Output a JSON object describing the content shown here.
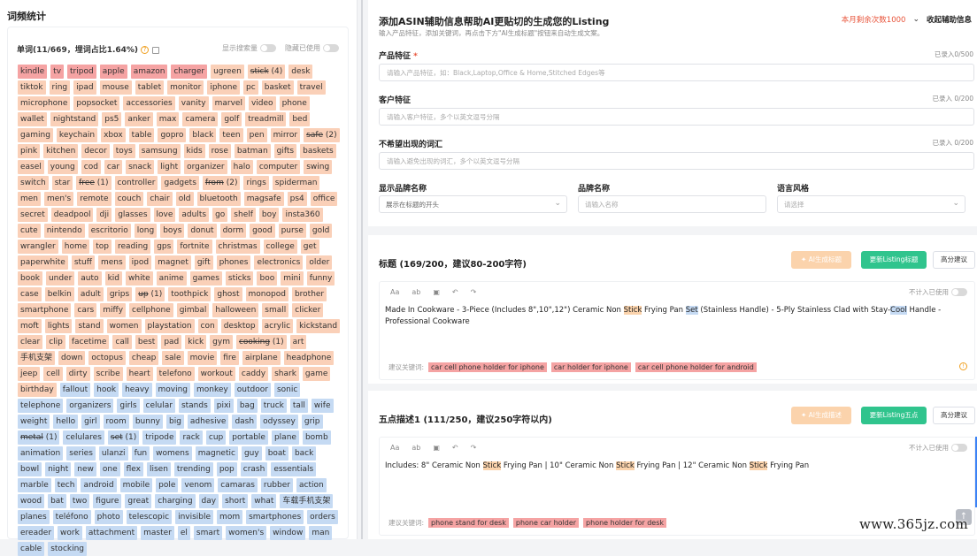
{
  "left": {
    "title": "词频统计",
    "stat": "单词(11/669，埋词占比1.64%)",
    "toggle_show_search": "显示搜索量",
    "toggle_hide_used": "隐藏已使用"
  },
  "tags": [
    {
      "t": "kindle",
      "c": "red"
    },
    {
      "t": "tv",
      "c": "red"
    },
    {
      "t": "tripod",
      "c": "red"
    },
    {
      "t": "apple",
      "c": "red"
    },
    {
      "t": "amazon",
      "c": "red"
    },
    {
      "t": "charger",
      "c": "red"
    },
    {
      "t": "ugreen",
      "c": "peach"
    },
    {
      "t": "stick",
      "c": "peach",
      "s": true,
      "n": "(4)"
    },
    {
      "t": "desk",
      "c": "peach"
    },
    {
      "t": "tiktok",
      "c": "peach"
    },
    {
      "t": "ring",
      "c": "peach"
    },
    {
      "t": "ipad",
      "c": "peach"
    },
    {
      "t": "mouse",
      "c": "peach"
    },
    {
      "t": "tablet",
      "c": "peach"
    },
    {
      "t": "monitor",
      "c": "peach"
    },
    {
      "t": "iphone",
      "c": "peach"
    },
    {
      "t": "pc",
      "c": "peach"
    },
    {
      "t": "basket",
      "c": "peach"
    },
    {
      "t": "travel",
      "c": "peach"
    },
    {
      "t": "microphone",
      "c": "peach"
    },
    {
      "t": "popsocket",
      "c": "peach"
    },
    {
      "t": "accessories",
      "c": "peach"
    },
    {
      "t": "vanity",
      "c": "peach"
    },
    {
      "t": "marvel",
      "c": "peach"
    },
    {
      "t": "video",
      "c": "peach"
    },
    {
      "t": "phone",
      "c": "peach"
    },
    {
      "t": "wallet",
      "c": "peach"
    },
    {
      "t": "nightstand",
      "c": "peach"
    },
    {
      "t": "ps5",
      "c": "peach"
    },
    {
      "t": "anker",
      "c": "peach"
    },
    {
      "t": "max",
      "c": "peach"
    },
    {
      "t": "camera",
      "c": "peach"
    },
    {
      "t": "golf",
      "c": "peach"
    },
    {
      "t": "treadmill",
      "c": "peach"
    },
    {
      "t": "bed",
      "c": "peach"
    },
    {
      "t": "gaming",
      "c": "peach"
    },
    {
      "t": "keychain",
      "c": "peach"
    },
    {
      "t": "xbox",
      "c": "peach"
    },
    {
      "t": "table",
      "c": "peach"
    },
    {
      "t": "gopro",
      "c": "peach"
    },
    {
      "t": "black",
      "c": "peach"
    },
    {
      "t": "teen",
      "c": "peach"
    },
    {
      "t": "pen",
      "c": "peach"
    },
    {
      "t": "mirror",
      "c": "peach"
    },
    {
      "t": "safe",
      "c": "peach",
      "s": true,
      "n": "(2)"
    },
    {
      "t": "pink",
      "c": "peach"
    },
    {
      "t": "kitchen",
      "c": "peach"
    },
    {
      "t": "decor",
      "c": "peach"
    },
    {
      "t": "toys",
      "c": "peach"
    },
    {
      "t": "samsung",
      "c": "peach"
    },
    {
      "t": "kids",
      "c": "peach"
    },
    {
      "t": "rose",
      "c": "peach"
    },
    {
      "t": "batman",
      "c": "peach"
    },
    {
      "t": "gifts",
      "c": "peach"
    },
    {
      "t": "baskets",
      "c": "peach"
    },
    {
      "t": "easel",
      "c": "peach"
    },
    {
      "t": "young",
      "c": "peach"
    },
    {
      "t": "cod",
      "c": "peach"
    },
    {
      "t": "car",
      "c": "peach"
    },
    {
      "t": "snack",
      "c": "peach"
    },
    {
      "t": "light",
      "c": "peach"
    },
    {
      "t": "organizer",
      "c": "peach"
    },
    {
      "t": "halo",
      "c": "peach"
    },
    {
      "t": "computer",
      "c": "peach"
    },
    {
      "t": "swing",
      "c": "peach"
    },
    {
      "t": "switch",
      "c": "peach"
    },
    {
      "t": "star",
      "c": "peach"
    },
    {
      "t": "free",
      "c": "peach",
      "s": true,
      "n": "(1)"
    },
    {
      "t": "controller",
      "c": "peach"
    },
    {
      "t": "gadgets",
      "c": "peach"
    },
    {
      "t": "from",
      "c": "peach",
      "s": true,
      "n": "(2)"
    },
    {
      "t": "rings",
      "c": "peach"
    },
    {
      "t": "spiderman",
      "c": "peach"
    },
    {
      "t": "men",
      "c": "peach"
    },
    {
      "t": "men's",
      "c": "peach"
    },
    {
      "t": "remote",
      "c": "peach"
    },
    {
      "t": "couch",
      "c": "peach"
    },
    {
      "t": "chair",
      "c": "peach"
    },
    {
      "t": "old",
      "c": "peach"
    },
    {
      "t": "bluetooth",
      "c": "peach"
    },
    {
      "t": "magsafe",
      "c": "peach"
    },
    {
      "t": "ps4",
      "c": "peach"
    },
    {
      "t": "office",
      "c": "peach"
    },
    {
      "t": "secret",
      "c": "peach"
    },
    {
      "t": "deadpool",
      "c": "peach"
    },
    {
      "t": "dji",
      "c": "peach"
    },
    {
      "t": "glasses",
      "c": "peach"
    },
    {
      "t": "love",
      "c": "peach"
    },
    {
      "t": "adults",
      "c": "peach"
    },
    {
      "t": "go",
      "c": "peach"
    },
    {
      "t": "shelf",
      "c": "peach"
    },
    {
      "t": "boy",
      "c": "peach"
    },
    {
      "t": "insta360",
      "c": "peach"
    },
    {
      "t": "cute",
      "c": "peach"
    },
    {
      "t": "nintendo",
      "c": "peach"
    },
    {
      "t": "escritorio",
      "c": "peach"
    },
    {
      "t": "long",
      "c": "peach"
    },
    {
      "t": "boys",
      "c": "peach"
    },
    {
      "t": "donut",
      "c": "peach"
    },
    {
      "t": "dorm",
      "c": "peach"
    },
    {
      "t": "good",
      "c": "peach"
    },
    {
      "t": "purse",
      "c": "peach"
    },
    {
      "t": "gold",
      "c": "peach"
    },
    {
      "t": "wrangler",
      "c": "peach"
    },
    {
      "t": "home",
      "c": "peach"
    },
    {
      "t": "top",
      "c": "peach"
    },
    {
      "t": "reading",
      "c": "peach"
    },
    {
      "t": "gps",
      "c": "peach"
    },
    {
      "t": "fortnite",
      "c": "peach"
    },
    {
      "t": "christmas",
      "c": "peach"
    },
    {
      "t": "college",
      "c": "peach"
    },
    {
      "t": "get",
      "c": "peach"
    },
    {
      "t": "paperwhite",
      "c": "peach"
    },
    {
      "t": "stuff",
      "c": "peach"
    },
    {
      "t": "mens",
      "c": "peach"
    },
    {
      "t": "ipod",
      "c": "peach"
    },
    {
      "t": "magnet",
      "c": "peach"
    },
    {
      "t": "gift",
      "c": "peach"
    },
    {
      "t": "phones",
      "c": "peach"
    },
    {
      "t": "electronics",
      "c": "peach"
    },
    {
      "t": "older",
      "c": "peach"
    },
    {
      "t": "book",
      "c": "peach"
    },
    {
      "t": "under",
      "c": "peach"
    },
    {
      "t": "auto",
      "c": "peach"
    },
    {
      "t": "kid",
      "c": "peach"
    },
    {
      "t": "white",
      "c": "peach"
    },
    {
      "t": "anime",
      "c": "peach"
    },
    {
      "t": "games",
      "c": "peach"
    },
    {
      "t": "sticks",
      "c": "peach"
    },
    {
      "t": "boo",
      "c": "peach"
    },
    {
      "t": "mini",
      "c": "peach"
    },
    {
      "t": "funny",
      "c": "peach"
    },
    {
      "t": "case",
      "c": "peach"
    },
    {
      "t": "belkin",
      "c": "peach"
    },
    {
      "t": "adult",
      "c": "peach"
    },
    {
      "t": "grips",
      "c": "peach"
    },
    {
      "t": "up",
      "c": "peach",
      "s": true,
      "n": "(1)"
    },
    {
      "t": "toothpick",
      "c": "peach"
    },
    {
      "t": "ghost",
      "c": "peach"
    },
    {
      "t": "monopod",
      "c": "peach"
    },
    {
      "t": "brother",
      "c": "peach"
    },
    {
      "t": "smartphone",
      "c": "peach"
    },
    {
      "t": "cars",
      "c": "peach"
    },
    {
      "t": "miffy",
      "c": "peach"
    },
    {
      "t": "cellphone",
      "c": "peach"
    },
    {
      "t": "gimbal",
      "c": "peach"
    },
    {
      "t": "halloween",
      "c": "peach"
    },
    {
      "t": "small",
      "c": "peach"
    },
    {
      "t": "clicker",
      "c": "peach"
    },
    {
      "t": "moft",
      "c": "peach"
    },
    {
      "t": "lights",
      "c": "peach"
    },
    {
      "t": "stand",
      "c": "peach"
    },
    {
      "t": "women",
      "c": "peach"
    },
    {
      "t": "playstation",
      "c": "peach"
    },
    {
      "t": "con",
      "c": "peach"
    },
    {
      "t": "desktop",
      "c": "peach"
    },
    {
      "t": "acrylic",
      "c": "peach"
    },
    {
      "t": "kickstand",
      "c": "peach"
    },
    {
      "t": "clear",
      "c": "peach"
    },
    {
      "t": "clip",
      "c": "peach"
    },
    {
      "t": "facetime",
      "c": "peach"
    },
    {
      "t": "call",
      "c": "peach"
    },
    {
      "t": "best",
      "c": "peach"
    },
    {
      "t": "pad",
      "c": "peach"
    },
    {
      "t": "kick",
      "c": "peach"
    },
    {
      "t": "gym",
      "c": "peach"
    },
    {
      "t": "cooking",
      "c": "peach",
      "s": true,
      "n": "(1)"
    },
    {
      "t": "art",
      "c": "peach"
    },
    {
      "t": "手机支架",
      "c": "peach"
    },
    {
      "t": "down",
      "c": "peach"
    },
    {
      "t": "octopus",
      "c": "peach"
    },
    {
      "t": "cheap",
      "c": "peach"
    },
    {
      "t": "sale",
      "c": "peach"
    },
    {
      "t": "movie",
      "c": "peach"
    },
    {
      "t": "fire",
      "c": "peach"
    },
    {
      "t": "airplane",
      "c": "peach"
    },
    {
      "t": "headphone",
      "c": "peach"
    },
    {
      "t": "jeep",
      "c": "peach"
    },
    {
      "t": "cell",
      "c": "peach"
    },
    {
      "t": "dirty",
      "c": "peach"
    },
    {
      "t": "scribe",
      "c": "peach"
    },
    {
      "t": "heart",
      "c": "peach"
    },
    {
      "t": "telefono",
      "c": "peach"
    },
    {
      "t": "workout",
      "c": "peach"
    },
    {
      "t": "caddy",
      "c": "peach"
    },
    {
      "t": "shark",
      "c": "peach"
    },
    {
      "t": "game",
      "c": "peach"
    },
    {
      "t": "birthday",
      "c": "peach"
    },
    {
      "t": "fallout",
      "c": "blue"
    },
    {
      "t": "hook",
      "c": "blue"
    },
    {
      "t": "heavy",
      "c": "blue"
    },
    {
      "t": "moving",
      "c": "blue"
    },
    {
      "t": "monkey",
      "c": "blue"
    },
    {
      "t": "outdoor",
      "c": "blue"
    },
    {
      "t": "sonic",
      "c": "blue"
    },
    {
      "t": "telephone",
      "c": "blue"
    },
    {
      "t": "organizers",
      "c": "blue"
    },
    {
      "t": "girls",
      "c": "blue"
    },
    {
      "t": "celular",
      "c": "blue"
    },
    {
      "t": "stands",
      "c": "blue"
    },
    {
      "t": "pixi",
      "c": "blue"
    },
    {
      "t": "bag",
      "c": "blue"
    },
    {
      "t": "truck",
      "c": "blue"
    },
    {
      "t": "tall",
      "c": "blue"
    },
    {
      "t": "wife",
      "c": "blue"
    },
    {
      "t": "weight",
      "c": "blue"
    },
    {
      "t": "hello",
      "c": "blue"
    },
    {
      "t": "girl",
      "c": "blue"
    },
    {
      "t": "room",
      "c": "blue"
    },
    {
      "t": "bunny",
      "c": "blue"
    },
    {
      "t": "big",
      "c": "blue"
    },
    {
      "t": "adhesive",
      "c": "blue"
    },
    {
      "t": "dash",
      "c": "blue"
    },
    {
      "t": "odyssey",
      "c": "blue"
    },
    {
      "t": "grip",
      "c": "blue"
    },
    {
      "t": "metal",
      "c": "blue",
      "s": true,
      "n": "(1)"
    },
    {
      "t": "celulares",
      "c": "blue"
    },
    {
      "t": "set",
      "c": "blue",
      "s": true,
      "n": "(1)"
    },
    {
      "t": "tripode",
      "c": "blue"
    },
    {
      "t": "rack",
      "c": "blue"
    },
    {
      "t": "cup",
      "c": "blue"
    },
    {
      "t": "portable",
      "c": "blue"
    },
    {
      "t": "plane",
      "c": "blue"
    },
    {
      "t": "bomb",
      "c": "blue"
    },
    {
      "t": "animation",
      "c": "blue"
    },
    {
      "t": "series",
      "c": "blue"
    },
    {
      "t": "ulanzi",
      "c": "blue"
    },
    {
      "t": "fun",
      "c": "blue"
    },
    {
      "t": "womens",
      "c": "blue"
    },
    {
      "t": "magnetic",
      "c": "blue"
    },
    {
      "t": "guy",
      "c": "blue"
    },
    {
      "t": "boat",
      "c": "blue"
    },
    {
      "t": "back",
      "c": "blue"
    },
    {
      "t": "bowl",
      "c": "blue"
    },
    {
      "t": "night",
      "c": "blue"
    },
    {
      "t": "new",
      "c": "blue"
    },
    {
      "t": "one",
      "c": "blue"
    },
    {
      "t": "flex",
      "c": "blue"
    },
    {
      "t": "lisen",
      "c": "blue"
    },
    {
      "t": "trending",
      "c": "blue"
    },
    {
      "t": "pop",
      "c": "blue"
    },
    {
      "t": "crash",
      "c": "blue"
    },
    {
      "t": "essentials",
      "c": "blue"
    },
    {
      "t": "marble",
      "c": "blue"
    },
    {
      "t": "tech",
      "c": "blue"
    },
    {
      "t": "android",
      "c": "blue"
    },
    {
      "t": "mobile",
      "c": "blue"
    },
    {
      "t": "pole",
      "c": "blue"
    },
    {
      "t": "venom",
      "c": "blue"
    },
    {
      "t": "camaras",
      "c": "blue"
    },
    {
      "t": "rubber",
      "c": "blue"
    },
    {
      "t": "action",
      "c": "blue"
    },
    {
      "t": "wood",
      "c": "blue"
    },
    {
      "t": "bat",
      "c": "blue"
    },
    {
      "t": "two",
      "c": "blue"
    },
    {
      "t": "figure",
      "c": "blue"
    },
    {
      "t": "great",
      "c": "blue"
    },
    {
      "t": "charging",
      "c": "blue"
    },
    {
      "t": "day",
      "c": "blue"
    },
    {
      "t": "short",
      "c": "blue"
    },
    {
      "t": "what",
      "c": "blue"
    },
    {
      "t": "车载手机支架",
      "c": "blue"
    },
    {
      "t": "planes",
      "c": "blue"
    },
    {
      "t": "teléfono",
      "c": "blue"
    },
    {
      "t": "photo",
      "c": "blue"
    },
    {
      "t": "telescopic",
      "c": "blue"
    },
    {
      "t": "invisible",
      "c": "blue"
    },
    {
      "t": "mom",
      "c": "blue"
    },
    {
      "t": "smartphones",
      "c": "blue"
    },
    {
      "t": "orders",
      "c": "blue"
    },
    {
      "t": "ereader",
      "c": "blue"
    },
    {
      "t": "work",
      "c": "blue"
    },
    {
      "t": "attachment",
      "c": "blue"
    },
    {
      "t": "master",
      "c": "blue"
    },
    {
      "t": "el",
      "c": "blue"
    },
    {
      "t": "smart",
      "c": "blue"
    },
    {
      "t": "women's",
      "c": "blue"
    },
    {
      "t": "window",
      "c": "blue"
    },
    {
      "t": "man",
      "c": "blue"
    },
    {
      "t": "cable",
      "c": "blue"
    },
    {
      "t": "stocking",
      "c": "blue"
    }
  ],
  "assist": {
    "title": "添加ASIN辅助信息帮助AI更贴切的生成您的Listing",
    "subtitle": "输入产品特征，添加关键词，再点击下方\"AI生成标题\"按钮来自动生成文案。",
    "quota": "本月剩余次数1000",
    "collapse": "收起辅助信息",
    "product_label": "产品特征",
    "product_count": "已录入0/500",
    "product_placeholder": "请输入产品特征，如：Black,Laptop,Office & Home,Stitched Edges等",
    "customer_label": "客户特征",
    "customer_count": "已录入 0/200",
    "customer_placeholder": "请输入客户特征，多个以英文逗号分隔",
    "exclude_label": "不希望出现的词汇",
    "exclude_count": "已录入 0/200",
    "exclude_placeholder": "请输入避免出现的词汇，多个以英文逗号分隔",
    "brand_display_label": "显示品牌名称",
    "brand_display_value": "展示在标题的开头",
    "brand_name_label": "品牌名称",
    "brand_name_placeholder": "请输入名称",
    "style_label": "语言风格",
    "style_placeholder": "请选择"
  },
  "title_section": {
    "heading": "标题 (169/200，建议80-200字符)",
    "ai_button": "✦ AI生成标题",
    "update_button": "更新Listing标题",
    "hi_button": "高分建议",
    "not_used": "不计入已使用",
    "content": [
      {
        "t": "Made In Cookware - 3-Piece (Includes 8\",10\",12\") Ceramic Non ",
        "h": ""
      },
      {
        "t": "Stick",
        "h": "hl"
      },
      {
        "t": " Frying Pan ",
        "h": ""
      },
      {
        "t": "Set",
        "h": "hlb"
      },
      {
        "t": " (Stainless Handle) - 5-Ply Stainless Clad with Stay-",
        "h": ""
      },
      {
        "t": "Cool",
        "h": "hlb"
      },
      {
        "t": " Handle - Professional Cookware",
        "h": ""
      }
    ],
    "suggest_label": "建议关键词:",
    "keywords": [
      "car cell phone holder for iphone",
      "car holder for iphone",
      "car cell phone holder for android"
    ]
  },
  "bullet_section": {
    "heading": "五点描述1 (111/250，建议250字符以内)",
    "ai_button": "✦ AI生成描述",
    "update_button": "更新Listing五点",
    "hi_button": "高分建议",
    "not_used": "不计入已使用",
    "content": [
      {
        "t": "Includes: 8\" Ceramic Non ",
        "h": ""
      },
      {
        "t": "Stick",
        "h": "hl"
      },
      {
        "t": " Frying Pan | 10\" Ceramic Non ",
        "h": ""
      },
      {
        "t": "Stick",
        "h": "hl"
      },
      {
        "t": " Frying Pan | 12\" Ceramic Non ",
        "h": ""
      },
      {
        "t": "Stick",
        "h": "hl"
      },
      {
        "t": " Frying Pan",
        "h": ""
      }
    ],
    "suggest_label": "建议关键词:",
    "keywords": [
      "phone stand for desk",
      "phone car holder",
      "phone holder for desk"
    ]
  },
  "toolbar": {
    "aa": "Aa",
    "ab": "ab",
    "undo": "↶",
    "redo": "↷"
  },
  "watermark": "www.365jz.com",
  "colors": {
    "accent_red": "#e8543a",
    "update_green": "#30c48d",
    "ai_orange": "#fbd3ac",
    "tag_red": "#f5a3a3",
    "tag_peach": "#fad0b8",
    "tag_blue": "#c5daf3"
  }
}
